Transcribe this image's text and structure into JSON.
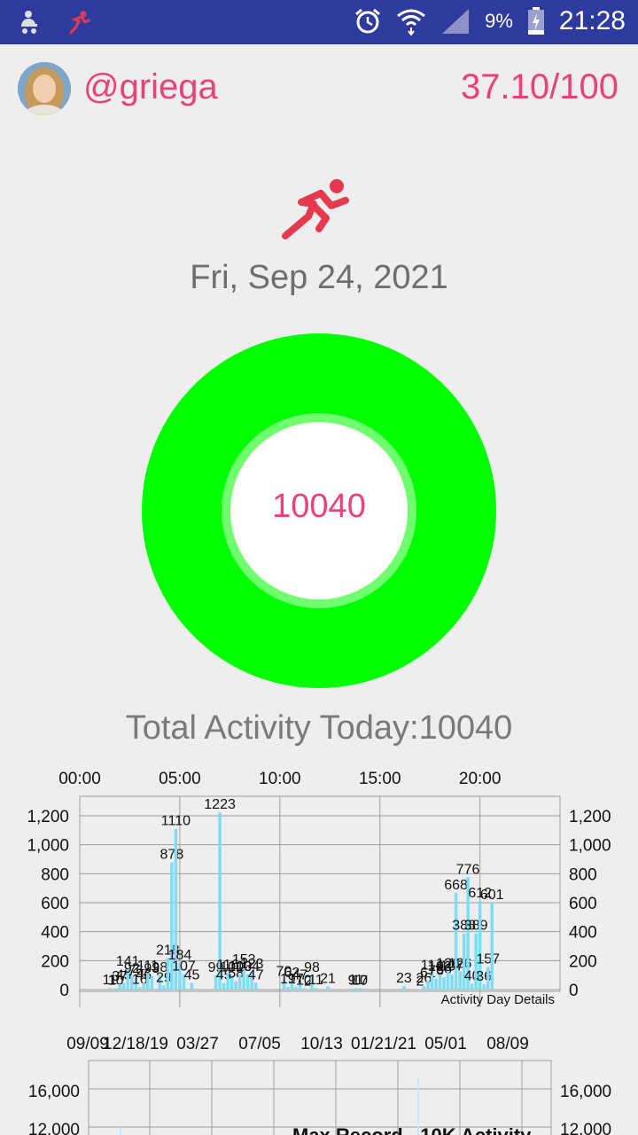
{
  "status_bar": {
    "battery_pct": "9%",
    "time": "21:28",
    "icons": [
      "baby-carriage-icon",
      "runner-icon",
      "alarm-icon",
      "wifi-icon",
      "signal-icon",
      "battery-charging-icon"
    ]
  },
  "profile": {
    "username": "@griega",
    "score": "37.10/100"
  },
  "date": "Fri, Sep 24, 2021",
  "donut": {
    "value": "10040",
    "colors": {
      "ring": "#00ff00",
      "inner_ring": "#6fff6f",
      "center": "#ffffff",
      "text": "#ec407a"
    }
  },
  "total_activity": "Total Activity Today:10040",
  "chart_data": [
    {
      "type": "bar",
      "title": "",
      "legend": "Activity Day Details",
      "x_ticks": [
        "00:00",
        "05:00",
        "10:00",
        "15:00",
        "20:00"
      ],
      "y_ticks": [
        "0",
        "200",
        "400",
        "600",
        "800",
        "1,000",
        "1,200"
      ],
      "ylim": [
        0,
        1300
      ],
      "xlim": [
        0,
        24
      ],
      "bars": [
        {
          "x": 1.5,
          "v": 11
        },
        {
          "x": 1.8,
          "v": 10
        },
        {
          "x": 2.0,
          "v": 37
        },
        {
          "x": 2.2,
          "v": 45
        },
        {
          "x": 2.4,
          "v": 141
        },
        {
          "x": 2.6,
          "v": 92
        },
        {
          "x": 2.8,
          "v": 76
        },
        {
          "x": 3.0,
          "v": 16
        },
        {
          "x": 3.2,
          "v": 46
        },
        {
          "x": 3.4,
          "v": 111
        },
        {
          "x": 3.6,
          "v": 93
        },
        {
          "x": 4.0,
          "v": 98
        },
        {
          "x": 4.2,
          "v": 29
        },
        {
          "x": 4.4,
          "v": 218
        },
        {
          "x": 4.6,
          "v": 878
        },
        {
          "x": 4.8,
          "v": 1110
        },
        {
          "x": 5.0,
          "v": 184
        },
        {
          "x": 5.2,
          "v": 107
        },
        {
          "x": 5.6,
          "v": 45
        },
        {
          "x": 6.8,
          "v": 99
        },
        {
          "x": 7.0,
          "v": 1223
        },
        {
          "x": 7.2,
          "v": 45
        },
        {
          "x": 7.4,
          "v": 116
        },
        {
          "x": 7.6,
          "v": 100
        },
        {
          "x": 7.8,
          "v": 58
        },
        {
          "x": 8.0,
          "v": 103
        },
        {
          "x": 8.2,
          "v": 153
        },
        {
          "x": 8.4,
          "v": 104
        },
        {
          "x": 8.6,
          "v": 123
        },
        {
          "x": 8.8,
          "v": 47
        },
        {
          "x": 10.2,
          "v": 70
        },
        {
          "x": 10.4,
          "v": 19
        },
        {
          "x": 10.6,
          "v": 62
        },
        {
          "x": 10.8,
          "v": 17
        },
        {
          "x": 11.0,
          "v": 47
        },
        {
          "x": 11.2,
          "v": 10
        },
        {
          "x": 11.4,
          "v": 2
        },
        {
          "x": 11.6,
          "v": 98
        },
        {
          "x": 11.8,
          "v": 11
        },
        {
          "x": 12.4,
          "v": 21
        },
        {
          "x": 13.6,
          "v": 9
        },
        {
          "x": 13.8,
          "v": 11
        },
        {
          "x": 14.0,
          "v": 10
        },
        {
          "x": 14.2,
          "v": 7
        },
        {
          "x": 16.2,
          "v": 23
        },
        {
          "x": 17.0,
          "v": 2
        },
        {
          "x": 17.2,
          "v": 26
        },
        {
          "x": 17.4,
          "v": 61
        },
        {
          "x": 17.6,
          "v": 114
        },
        {
          "x": 17.8,
          "v": 76
        },
        {
          "x": 18.0,
          "v": 103
        },
        {
          "x": 18.2,
          "v": 86
        },
        {
          "x": 18.4,
          "v": 126
        },
        {
          "x": 18.6,
          "v": 107
        },
        {
          "x": 18.8,
          "v": 668
        },
        {
          "x": 19.0,
          "v": 126
        },
        {
          "x": 19.2,
          "v": 388
        },
        {
          "x": 19.4,
          "v": 776
        },
        {
          "x": 19.6,
          "v": 40
        },
        {
          "x": 19.8,
          "v": 389
        },
        {
          "x": 20.0,
          "v": 612
        },
        {
          "x": 20.2,
          "v": 36
        },
        {
          "x": 20.4,
          "v": 157
        },
        {
          "x": 20.6,
          "v": 601
        }
      ]
    },
    {
      "type": "bar",
      "title": "Max Record - 10K Activity",
      "x_ticks": [
        "09/09",
        "12/18/19",
        "03/27",
        "07/05",
        "10/13",
        "01/21/21",
        "05/01",
        "08/09"
      ],
      "y_ticks": [
        "12,000",
        "16,000"
      ],
      "values_note_hidden": true
    }
  ]
}
